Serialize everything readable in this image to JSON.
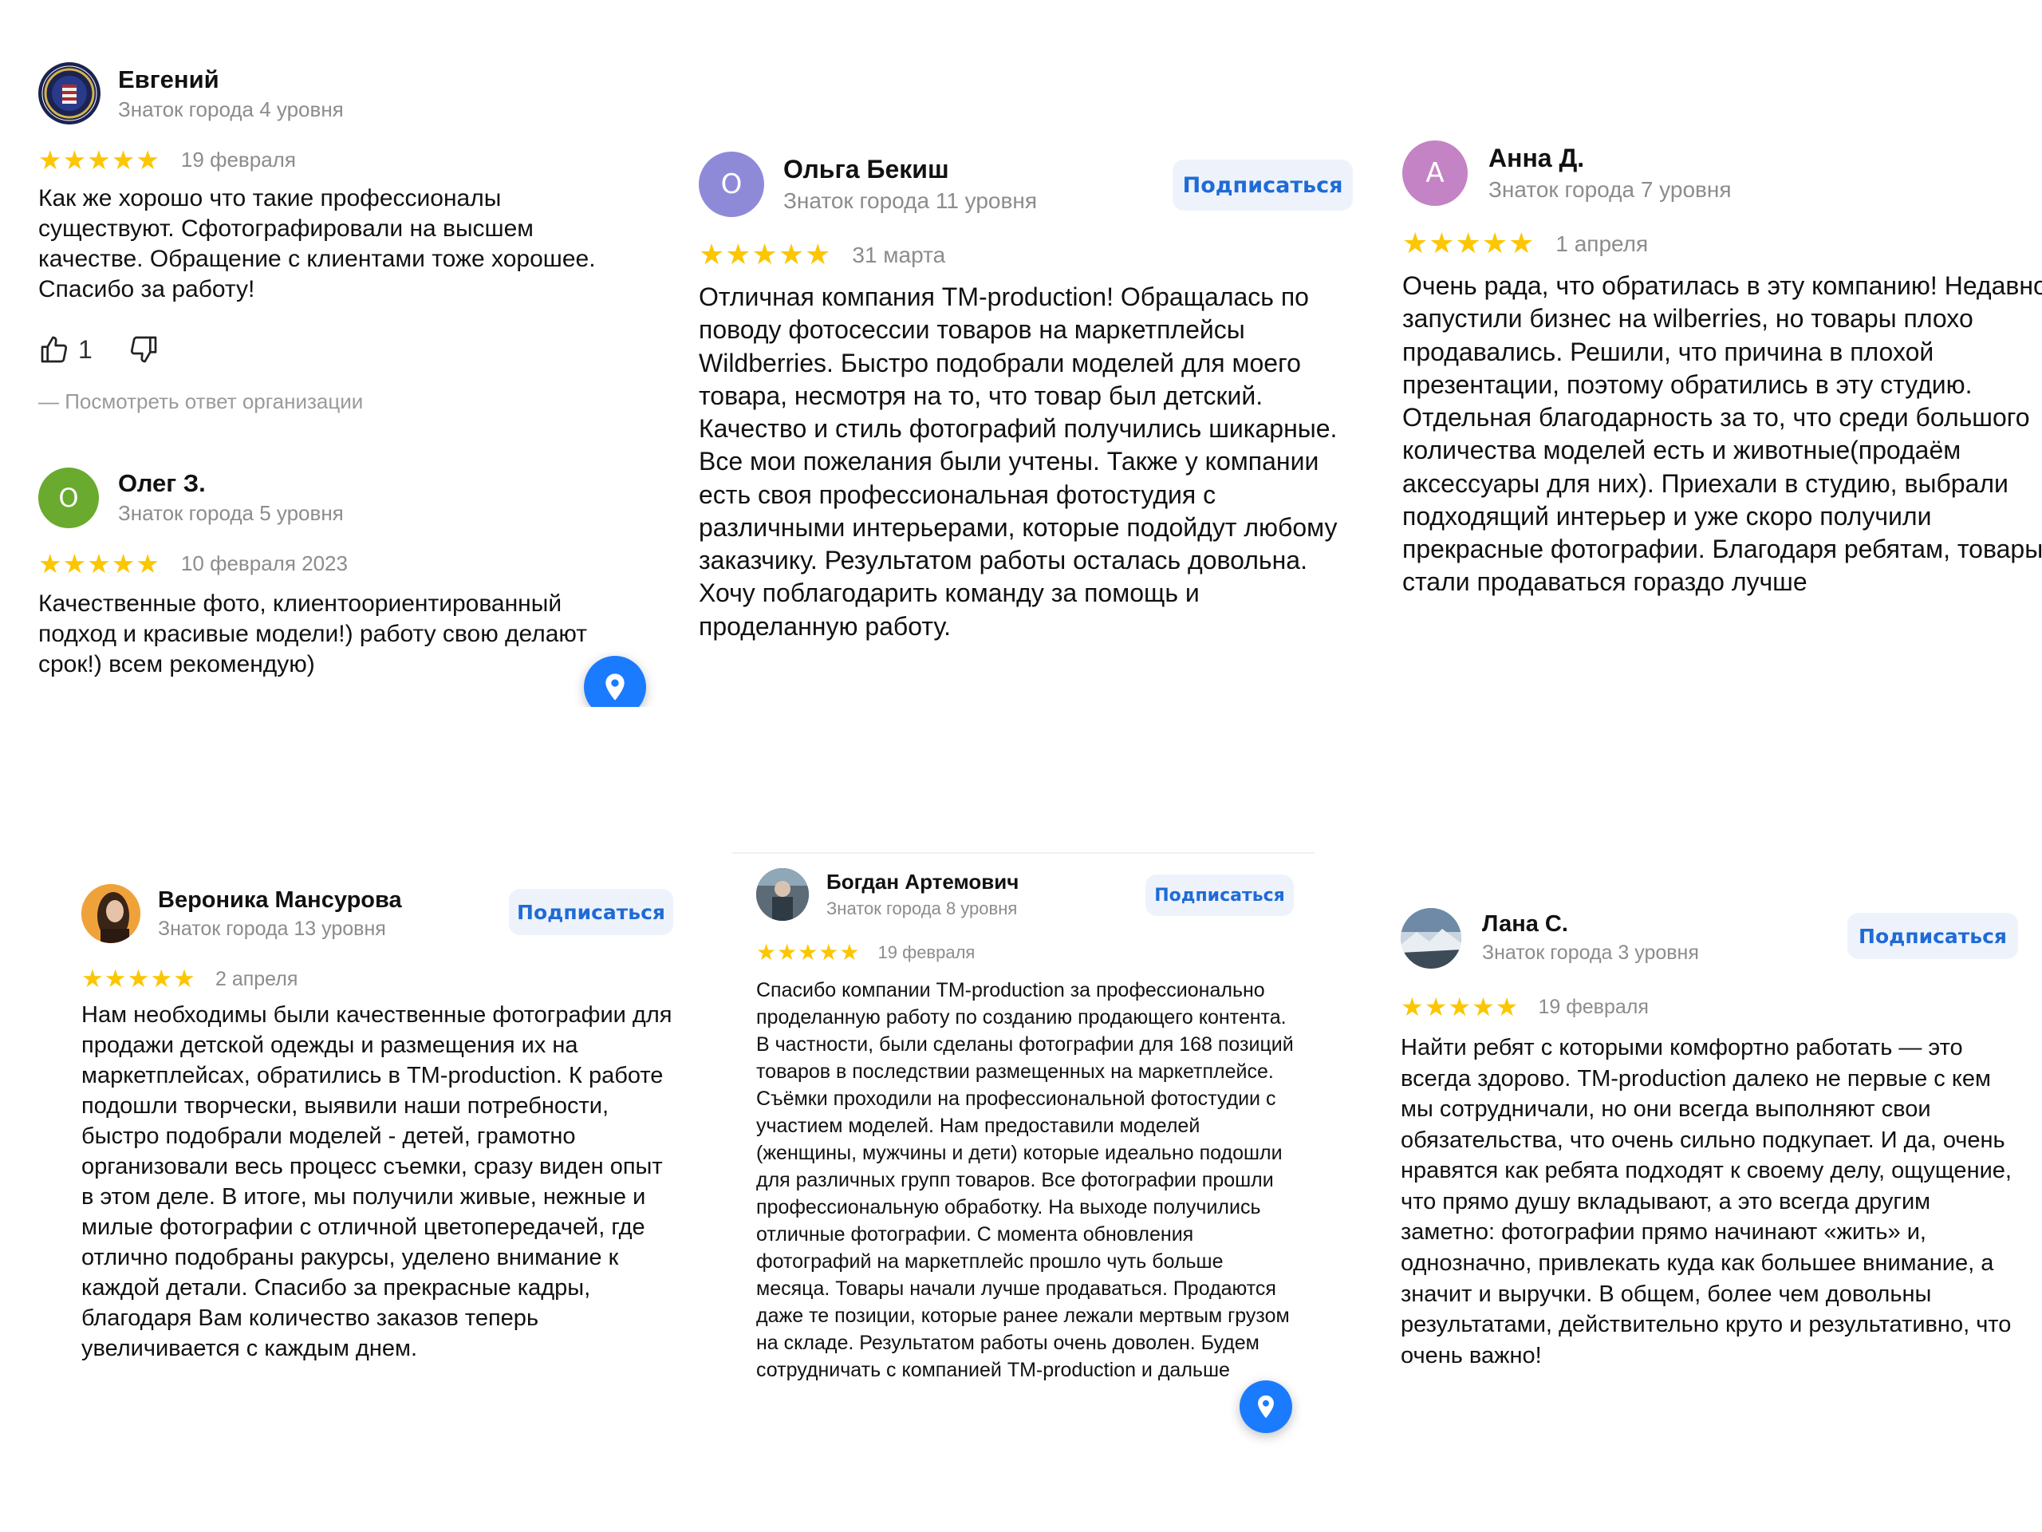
{
  "reviews": [
    {
      "name": "Евгений",
      "level": "Знаток города 4 уровня",
      "stars": "★★★★★",
      "date": "19 февраля",
      "text": "Как же хорошо что такие профессионалы существуют. Сфотографировали на высшем качестве. Обращение с клиентами тоже хорошее. Спасибо за работу!",
      "likes": "1",
      "reply_link": "—  Посмотреть ответ организации"
    },
    {
      "name": "Олег З.",
      "avatar_letter": "О",
      "level": "Знаток города 5 уровня",
      "stars": "★★★★★",
      "date": "10 февраля 2023",
      "text": "Качественные фото, клиентоориентированный подход и красивые модели!) работу свою делают срок!) всем рекомендую)"
    },
    {
      "name": "Ольга Бекиш",
      "avatar_letter": "О",
      "level": "Знаток города 11 уровня",
      "subscribe": "Подписаться",
      "stars": "★★★★★",
      "date": "31 марта",
      "text": "Отличная компания ТМ-production! Обращалась по поводу фотосессии товаров на маркетплейсы Wildberries. Быстро подобрали моделей для моего товара, несмотря на то, что товар был детский. Качество и стиль фотографий получились шикарные. Все мои пожелания были учтены. Также у компании есть своя профессиональная фотостудия с различными интерьерами, которые подойдут любому заказчику. Результатом работы осталась довольна. Хочу поблагодарить команду за помощь и проделанную работу."
    },
    {
      "name": "Анна Д.",
      "avatar_letter": "А",
      "level": "Знаток города 7 уровня",
      "stars": "★★★★★",
      "date": "1 апреля",
      "text": "Очень рада, что обратилась в эту компанию! Недавно запустили бизнес на wilberries, но товары плохо продавались. Решили, что причина в плохой презентации, поэтому обратились в эту студию. Отдельная благодарность за то, что среди большого количества моделей есть и животные(продаём аксессуары для них). Приехали в студию, выбрали подходящий интерьер и уже скоро получили прекрасные фотографии. Благодаря ребятам, товары стали продаваться гораздо лучше"
    },
    {
      "name": "Вероника Мансурова",
      "level": "Знаток города 13 уровня",
      "subscribe": "Подписаться",
      "stars": "★★★★★",
      "date": "2 апреля",
      "text": "Нам необходимы были качественные фотографии для продажи детской одежды и размещения их на маркетплейсах, обратились в ТМ-production. К работе подошли творчески, выявили наши потребности, быстро подобрали моделей - детей, грамотно организовали весь процесс съемки, сразу виден опыт в этом деле. В итоге, мы получили живые, нежные и милые фотографии с отличной цветопередачей, где отлично подобраны ракурсы, уделено внимание к каждой детали. Спасибо за прекрасные кадры, благодаря Вам количество заказов теперь увеличивается с каждым днем."
    },
    {
      "name": "Богдан Артемович",
      "level": "Знаток города 8 уровня",
      "subscribe": "Подписаться",
      "stars": "★★★★★",
      "date": "19 февраля",
      "text": "Спасибо компании ТМ-production за профессионально проделанную работу по созданию продающего контента. В частности, были сделаны фотографии для 168 позиций товаров в последствии размещенных на маркетплейсе. Съёмки проходили на профессиональной фотостудии с участием моделей. Нам предоставили моделей (женщины, мужчины и дети) которые идеально подошли для различных групп товаров. Все фотографии прошли профессиональную обработку. На выходе получились отличные фотографии. С момента обновления фотографий на маркетплейс прошло чуть больше месяца. Товары начали лучше продаваться. Продаются даже те позиции, которые ранее лежали мертвым грузом на складе. Результатом работы очень доволен. Будем сотрудничать с компанией ТМ-production и дальше"
    },
    {
      "name": "Лана С.",
      "level": "Знаток города 3 уровня",
      "subscribe": "Подписаться",
      "stars": "★★★★★",
      "date": "19 февраля",
      "text": "Найти ребят с которыми комфортно работать — это всегда здорово. ТМ-production далеко не первые с кем мы сотрудничали, но они всегда выполняют свои обязательства, что очень сильно подкупает. И да, очень нравятся как ребята подходят к своему делу, ощущение, что прямо душу вкладывают, а это всегда другим заметно: фотографии прямо начинают «жить» и, однозначно, привлекать куда как большее внимание, а значит и выручки. В общем, более чем довольны результатами, действительно круто и результативно, что очень важно!"
    }
  ],
  "colors": {
    "star": "#fcc600",
    "subscribe_text": "#1f6bd6",
    "subscribe_bg": "#eef3fb",
    "avatar_oleg": "#6aaa2e",
    "avatar_olga": "#8f8ad8",
    "avatar_anna": "#c483c4",
    "map_button": "#1b7bff"
  },
  "icons": [
    "like-icon",
    "dislike-icon",
    "map-pin-icon",
    "fbi-seal-avatar"
  ]
}
